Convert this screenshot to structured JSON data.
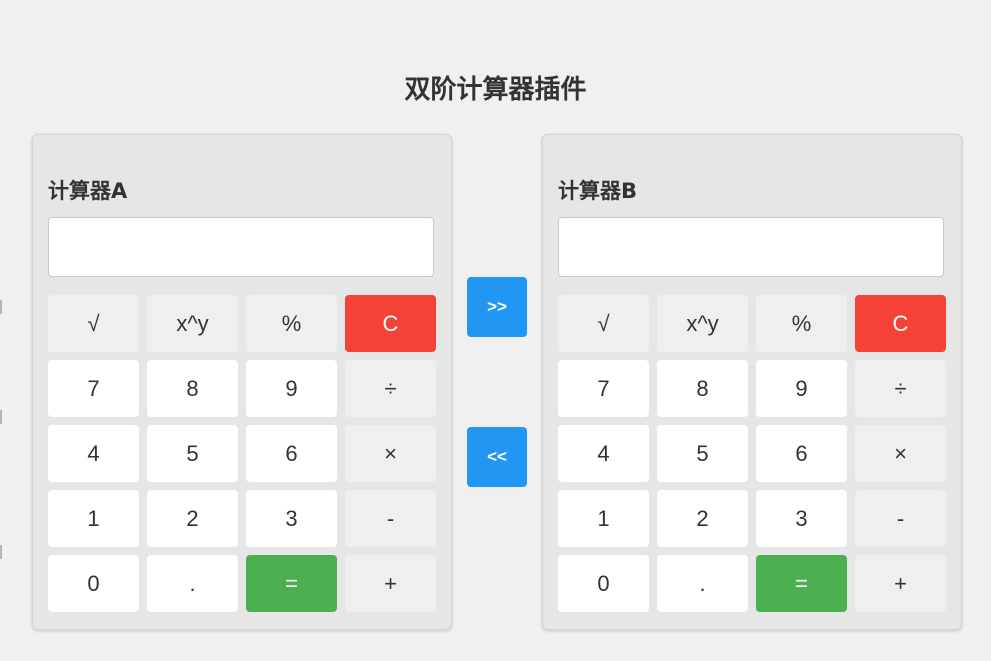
{
  "page": {
    "title": "双阶计算器插件"
  },
  "calculators": {
    "a": {
      "title": "计算器A",
      "display_value": ""
    },
    "b": {
      "title": "计算器B",
      "display_value": ""
    }
  },
  "transfer": {
    "to_b_label": ">>",
    "to_a_label": "<<"
  },
  "keys": [
    {
      "label": "√",
      "role": "op",
      "name": "sqrt"
    },
    {
      "label": "x^y",
      "role": "op",
      "name": "power"
    },
    {
      "label": "%",
      "role": "op",
      "name": "percent"
    },
    {
      "label": "C",
      "role": "clear",
      "name": "clear"
    },
    {
      "label": "7",
      "role": "num",
      "name": "digit-7"
    },
    {
      "label": "8",
      "role": "num",
      "name": "digit-8"
    },
    {
      "label": "9",
      "role": "num",
      "name": "digit-9"
    },
    {
      "label": "÷",
      "role": "op",
      "name": "divide"
    },
    {
      "label": "4",
      "role": "num",
      "name": "digit-4"
    },
    {
      "label": "5",
      "role": "num",
      "name": "digit-5"
    },
    {
      "label": "6",
      "role": "num",
      "name": "digit-6"
    },
    {
      "label": "×",
      "role": "op",
      "name": "multiply"
    },
    {
      "label": "1",
      "role": "num",
      "name": "digit-1"
    },
    {
      "label": "2",
      "role": "num",
      "name": "digit-2"
    },
    {
      "label": "3",
      "role": "num",
      "name": "digit-3"
    },
    {
      "label": "-",
      "role": "op",
      "name": "subtract"
    },
    {
      "label": "0",
      "role": "num",
      "name": "digit-0"
    },
    {
      "label": ".",
      "role": "num",
      "name": "decimal-point"
    },
    {
      "label": "=",
      "role": "equals",
      "name": "equals"
    },
    {
      "label": "+",
      "role": "op",
      "name": "add"
    }
  ],
  "colors": {
    "background": "#f0f0f0",
    "panel": "#e6e6e6",
    "clear": "#f44336",
    "equals": "#4caf50",
    "transfer": "#2196f3"
  }
}
